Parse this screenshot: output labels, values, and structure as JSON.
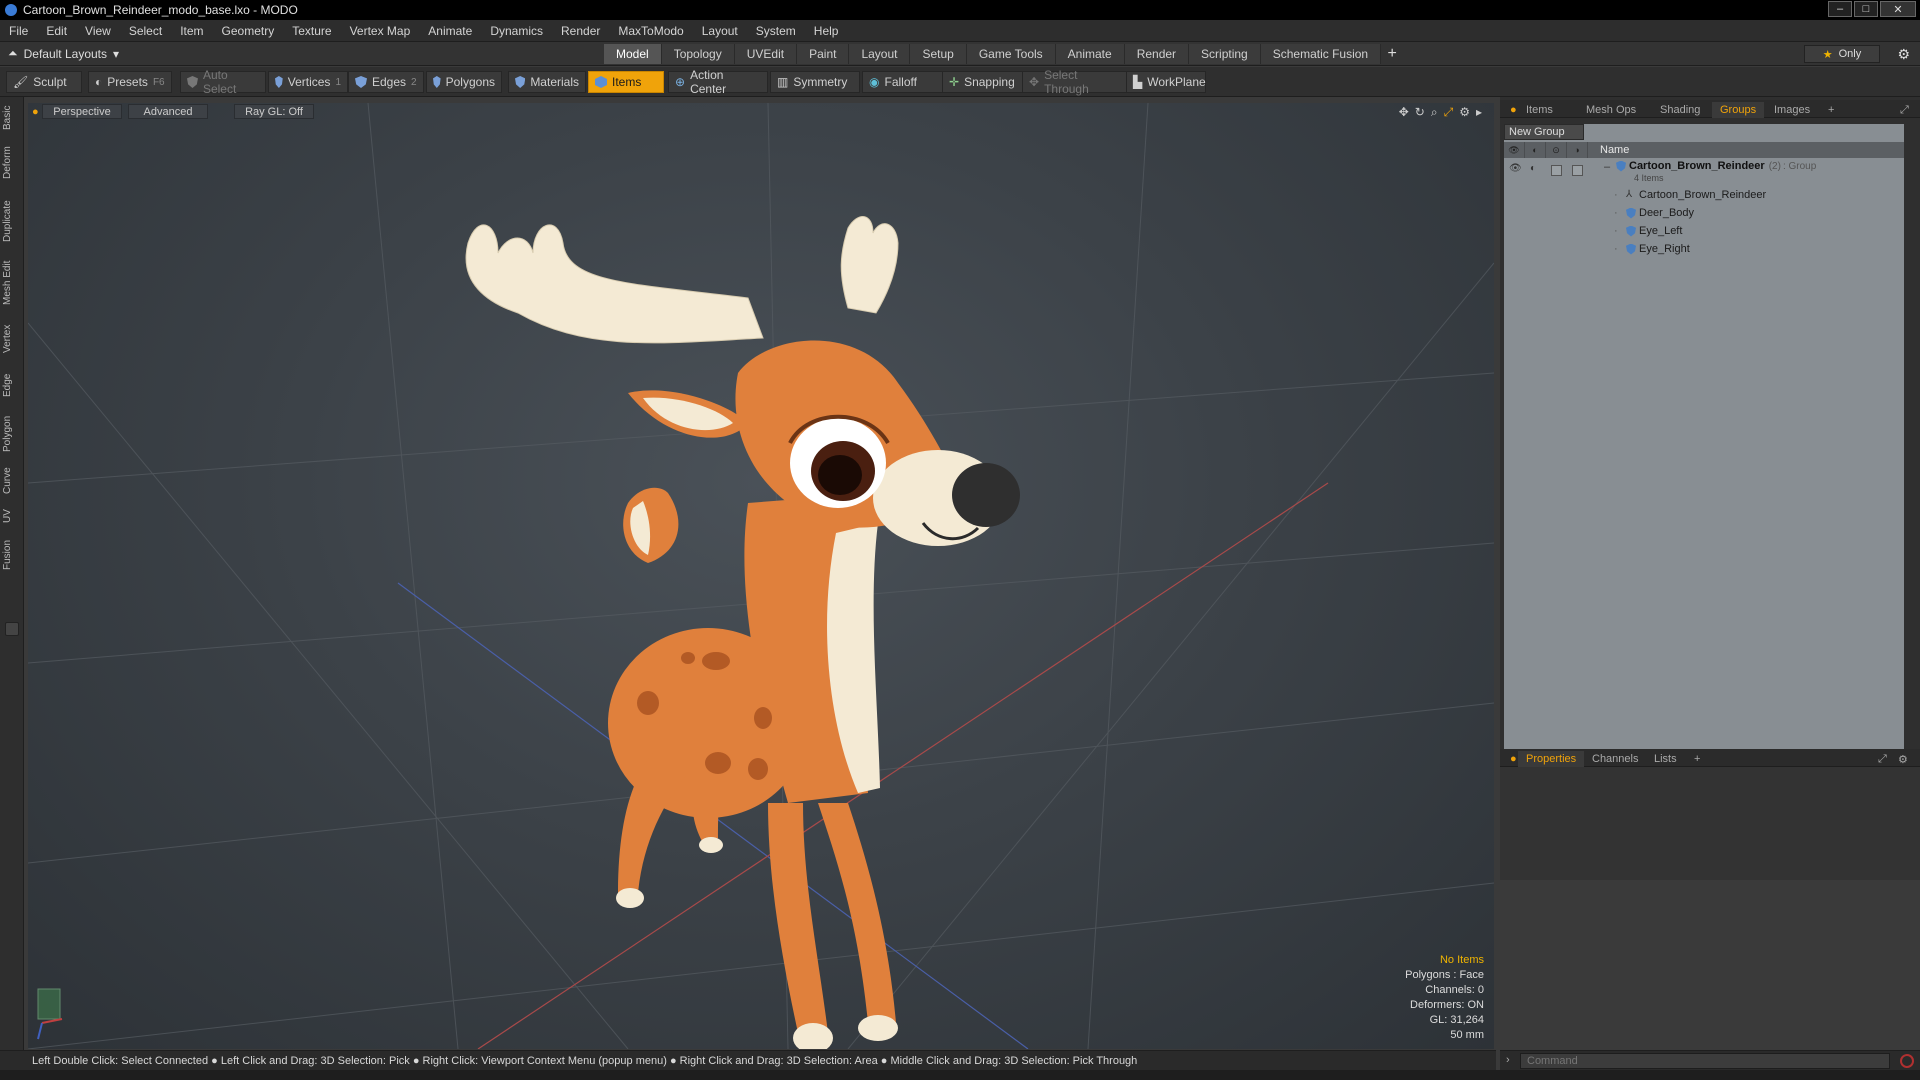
{
  "window": {
    "title": "Cartoon_Brown_Reindeer_modo_base.lxo - MODO",
    "min": "–",
    "max": "□",
    "close": "✕"
  },
  "menu": [
    "File",
    "Edit",
    "View",
    "Select",
    "Item",
    "Geometry",
    "Texture",
    "Vertex Map",
    "Animate",
    "Dynamics",
    "Render",
    "MaxToModo",
    "Layout",
    "System",
    "Help"
  ],
  "layoutbar": {
    "layout_name": "Default Layouts",
    "tabs": [
      "Model",
      "Topology",
      "UVEdit",
      "Paint",
      "Layout",
      "Setup",
      "Game Tools",
      "Animate",
      "Render",
      "Scripting",
      "Schematic Fusion"
    ],
    "active_tab": "Model",
    "add": "+",
    "only_label": "Only"
  },
  "toolbar": {
    "sculpt": "Sculpt",
    "presets": "Presets",
    "presets_key": "F6",
    "auto_select": "Auto Select",
    "vertices": "Vertices",
    "vertices_key": "1",
    "edges": "Edges",
    "edges_key": "2",
    "polygons": "Polygons",
    "materials": "Materials",
    "items": "Items",
    "action_center": "Action Center",
    "symmetry": "Symmetry",
    "falloff": "Falloff",
    "snapping": "Snapping",
    "select_through": "Select Through",
    "workplane": "WorkPlane"
  },
  "leftstrip": [
    "Basic",
    "Deform",
    "Duplicate",
    "Mesh Edit",
    "Vertex",
    "Edge",
    "Polygon",
    "Curve",
    "UV",
    "Fusion"
  ],
  "viewport": {
    "view_mode": "Perspective",
    "shading": "Advanced",
    "raygl": "Ray GL: Off",
    "info": {
      "selection": "No Items",
      "polygons": "Polygons : Face",
      "channels": "Channels: 0",
      "deformers": "Deformers: ON",
      "gl": "GL: 31,264",
      "focal": "50 mm"
    }
  },
  "rightpanel": {
    "tabs": [
      "Items",
      "Mesh Ops",
      "Shading",
      "Groups",
      "Images"
    ],
    "active_tab": "Groups",
    "add": "+",
    "new_group": "New Group",
    "name_header": "Name",
    "group": {
      "name": "Cartoon_Brown_Reindeer",
      "count": "(2)",
      "type": ": Group",
      "sub": "4 Items"
    },
    "items": [
      "Cartoon_Brown_Reindeer",
      "Deer_Body",
      "Eye_Left",
      "Eye_Right"
    ],
    "bottom_tabs": [
      "Properties",
      "Channels",
      "Lists"
    ],
    "bottom_active": "Properties"
  },
  "statusbar": "Left Double Click: Select Connected ● Left Click and Drag: 3D Selection: Pick ● Right Click: Viewport Context Menu (popup menu) ● Right Click and Drag: 3D Selection: Area ● Middle Click and Drag: 3D Selection: Pick Through",
  "command": {
    "placeholder": "Command"
  },
  "colors": {
    "accent": "#f0a30a",
    "viewport_bg": "#3c4248",
    "deer_body": "#e0803c",
    "deer_cream": "#f4ead4"
  }
}
